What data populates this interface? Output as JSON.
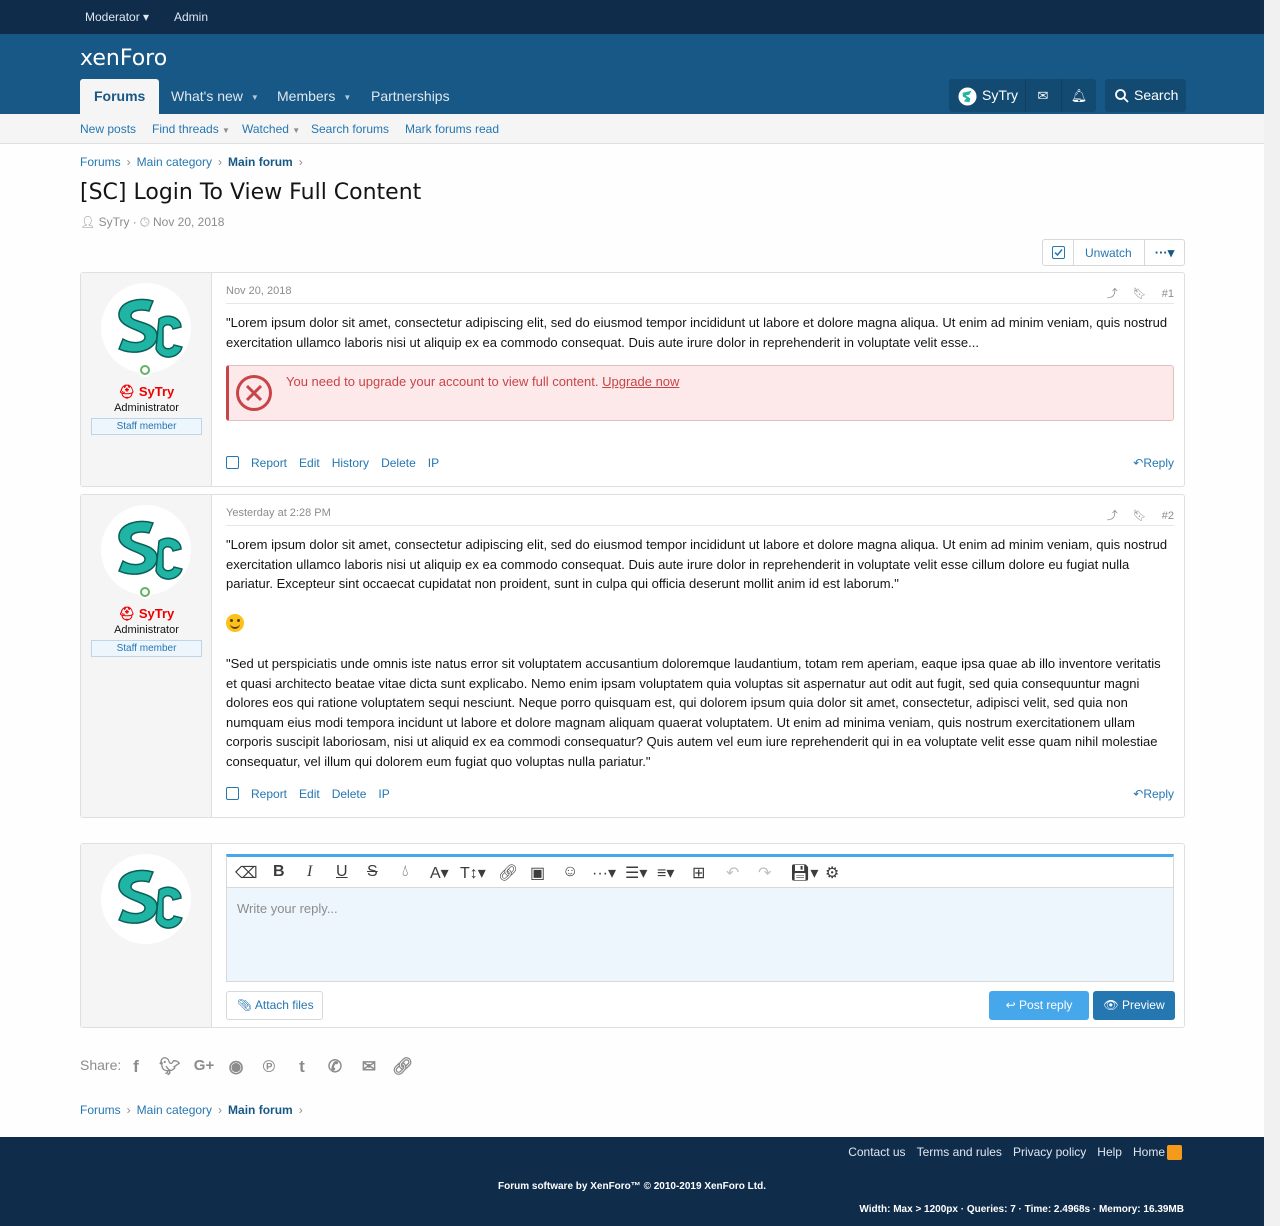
{
  "modbar": {
    "moderator": "Moderator",
    "admin": "Admin"
  },
  "header": {
    "logo": "xenForo",
    "tabs": [
      {
        "label": "Forums"
      },
      {
        "label": "What's new"
      },
      {
        "label": "Members"
      },
      {
        "label": "Partnerships"
      }
    ],
    "user": "SyTry",
    "search": "Search"
  },
  "subnav": [
    "New posts",
    "Find threads",
    "Watched",
    "Search forums",
    "Mark forums read"
  ],
  "breadcrumb": {
    "items": [
      "Forums",
      "Main category",
      "Main forum"
    ]
  },
  "thread": {
    "title": "[SC] Login To View Full Content",
    "author": "SyTry",
    "date": "Nov 20, 2018",
    "unwatch": "Unwatch"
  },
  "posts": [
    {
      "username": "SyTry",
      "usertitle": "Administrator",
      "badge": "Staff member",
      "date": "Nov 20, 2018",
      "number": "#1",
      "text": "\"Lorem ipsum dolor sit amet, consectetur adipiscing elit, sed do eiusmod tempor incididunt ut labore et dolore magna aliqua. Ut enim ad minim veniam, quis nostrud exercitation ullamco laboris nisi ut aliquip ex ea commodo consequat. Duis aute irure dolor in reprehenderit in voluptate velit esse...",
      "alert": "You need to upgrade your account to view full content.",
      "alert_link": "Upgrade now",
      "actions": [
        "Report",
        "Edit",
        "History",
        "Delete",
        "IP"
      ],
      "reply": "Reply"
    },
    {
      "username": "SyTry",
      "usertitle": "Administrator",
      "badge": "Staff member",
      "date": "Yesterday at 2:28 PM",
      "number": "#2",
      "text": "\"Lorem ipsum dolor sit amet, consectetur adipiscing elit, sed do eiusmod tempor incididunt ut labore et dolore magna aliqua. Ut enim ad minim veniam, quis nostrud exercitation ullamco laboris nisi ut aliquip ex ea commodo consequat. Duis aute irure dolor in reprehenderit in voluptate velit esse cillum dolore eu fugiat nulla pariatur. Excepteur sint occaecat cupidatat non proident, sunt in culpa qui officia deserunt mollit anim id est laborum.\"",
      "text2": "\"Sed ut perspiciatis unde omnis iste natus error sit voluptatem accusantium doloremque laudantium, totam rem aperiam, eaque ipsa quae ab illo inventore veritatis et quasi architecto beatae vitae dicta sunt explicabo. Nemo enim ipsam voluptatem quia voluptas sit aspernatur aut odit aut fugit, sed quia consequuntur magni dolores eos qui ratione voluptatem sequi nesciunt. Neque porro quisquam est, qui dolorem ipsum quia dolor sit amet, consectetur, adipisci velit, sed quia non numquam eius modi tempora incidunt ut labore et dolore magnam aliquam quaerat voluptatem. Ut enim ad minima veniam, quis nostrum exercitationem ullam corporis suscipit laboriosam, nisi ut aliquid ex ea commodi consequatur? Quis autem vel eum iure reprehenderit qui in ea voluptate velit esse quam nihil molestiae consequatur, vel illum qui dolorem eum fugiat quo voluptas nulla pariatur.\"",
      "actions": [
        "Report",
        "Edit",
        "Delete",
        "IP"
      ],
      "reply": "Reply"
    }
  ],
  "editor": {
    "placeholder": "Write your reply...",
    "attach": "Attach files",
    "post": "Post reply",
    "preview": "Preview"
  },
  "share": {
    "label": "Share:"
  },
  "footer": {
    "links": [
      "Contact us",
      "Terms and rules",
      "Privacy policy",
      "Help",
      "Home"
    ],
    "copyright": "Forum software by XenForo™ © 2010-2019 XenForo Ltd.",
    "debug": "Width: Max > 1200px · Queries: 7 · Time: 2.4968s · Memory: 16.39MB"
  },
  "colors": {
    "header": "#185886",
    "footer": "#0f2c4b",
    "accent": "#2577b1",
    "error": "#c84448"
  }
}
